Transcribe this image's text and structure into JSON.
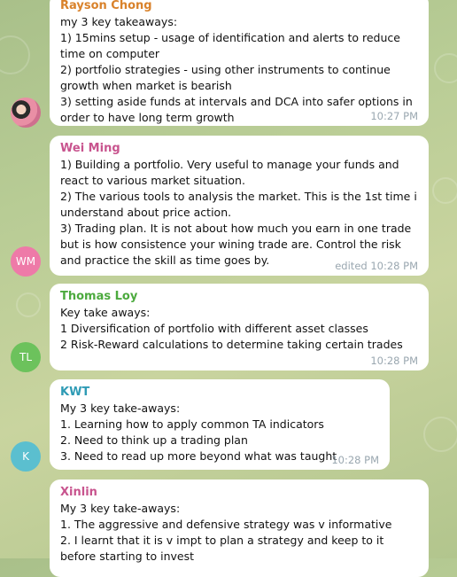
{
  "messages": [
    {
      "sender": "Rayson Chong",
      "sender_color": "#d9822b",
      "text": "my 3 key takeaways:\n1) 15mins setup - usage of identification and alerts to reduce time on computer\n2) portfolio strategies - using other instruments to continue growth when market is bearish\n3) setting aside funds at intervals and DCA into safer options in order to have long term growth",
      "time": "10:27 PM",
      "avatar_initials": ""
    },
    {
      "sender": "Wei Ming",
      "sender_color": "#c8548e",
      "text": "1) Building a portfolio. Very useful to manage your funds and react to various market situation.\n2) The various tools to analysis the market. This is the 1st time i understand about price action.\n3) Trading plan. It is not about how much you earn in one trade but is how consistence your wining trade are. Control the risk and practice the skill as time goes by.",
      "time": "edited 10:28 PM",
      "avatar_initials": "WM",
      "avatar_color": "#ee7aa8"
    },
    {
      "sender": "Thomas Loy",
      "sender_color": "#4caa3e",
      "text": "Key take aways:\n1 Diversification of portfolio with different asset classes\n2 Risk-Reward calculations to determine taking certain trades",
      "time": "10:28 PM",
      "avatar_initials": "TL",
      "avatar_color": "#6cc25c"
    },
    {
      "sender": "KWT",
      "sender_color": "#2f9bb5",
      "text": "My 3 key take-aways:\n1. Learning how to apply common TA indicators\n2. Need to think up a trading plan\n3. Need to read up more beyond what was taught",
      "time": "10:28 PM",
      "avatar_initials": "K",
      "avatar_color": "#5bbfcf"
    },
    {
      "sender": "Xinlin",
      "sender_color": "#c8548e",
      "text": "My 3 key take-aways:\n1. The aggressive and defensive strategy was v informative\n2. I learnt that it is v impt to plan a strategy and keep to it before starting to invest",
      "time": "",
      "avatar_initials": ""
    }
  ]
}
